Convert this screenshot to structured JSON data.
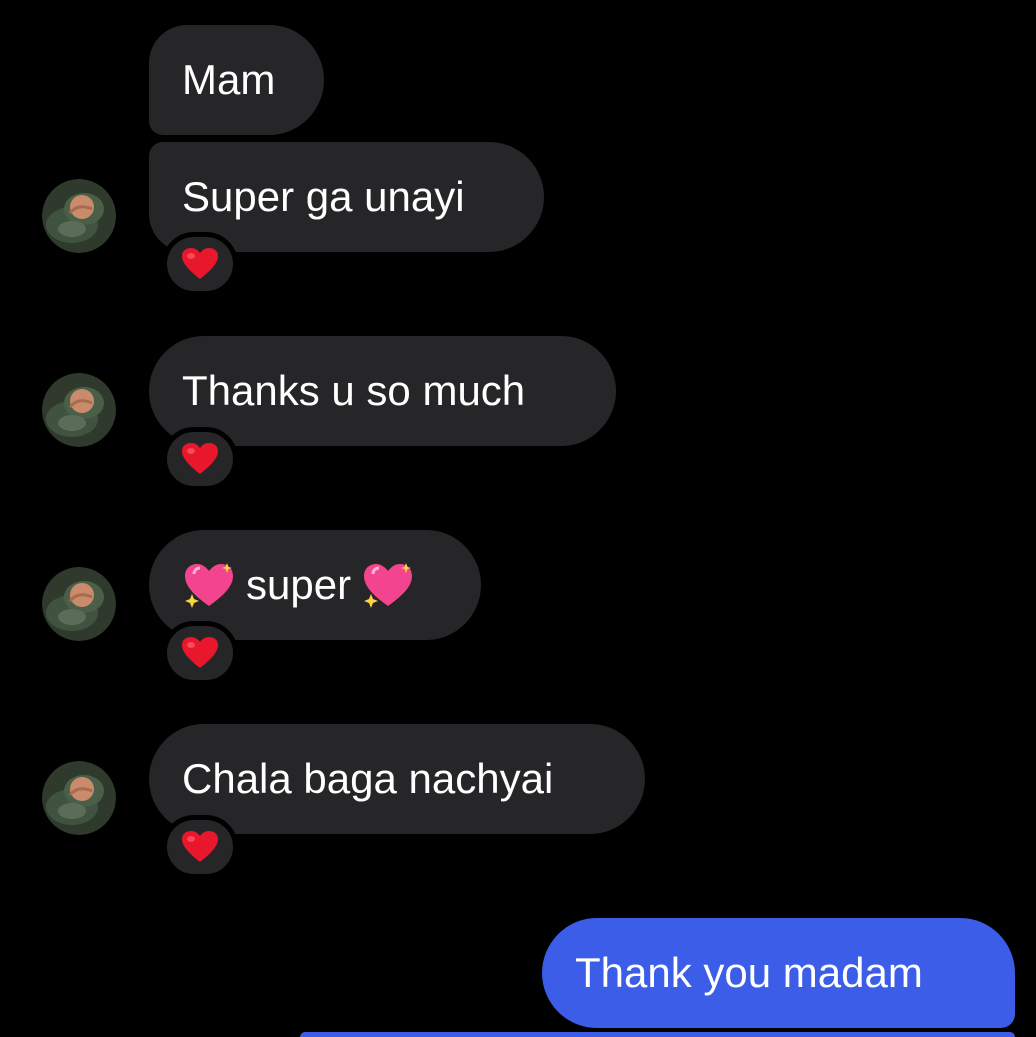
{
  "messages": [
    {
      "id": "m1",
      "direction": "incoming",
      "text": "Mam",
      "reaction": null,
      "show_avatar": false
    },
    {
      "id": "m2",
      "direction": "incoming",
      "text": "Super ga unayi",
      "reaction": "heart",
      "show_avatar": true
    },
    {
      "id": "m3",
      "direction": "incoming",
      "text": "Thanks u so much",
      "reaction": "heart",
      "show_avatar": true
    },
    {
      "id": "m4",
      "direction": "incoming",
      "text": "super",
      "prefix_emoji": "sparkling-heart",
      "suffix_emoji": "sparkling-heart",
      "reaction": "heart",
      "show_avatar": true
    },
    {
      "id": "m5",
      "direction": "incoming",
      "text": "Chala baga nachyai",
      "reaction": "heart",
      "show_avatar": true
    },
    {
      "id": "m6",
      "direction": "outgoing",
      "text": "Thank you madam",
      "reaction": null,
      "show_avatar": false
    }
  ],
  "colors": {
    "background": "#000000",
    "incoming_bubble": "#262628",
    "outgoing_bubble": "#3b5de7",
    "text": "#ffffff",
    "reaction_heart": "#e8172c"
  },
  "icons": {
    "avatar": "avatar-baby-photo",
    "reaction": "red-heart-icon",
    "sparkle": "sparkling-heart-icon"
  }
}
